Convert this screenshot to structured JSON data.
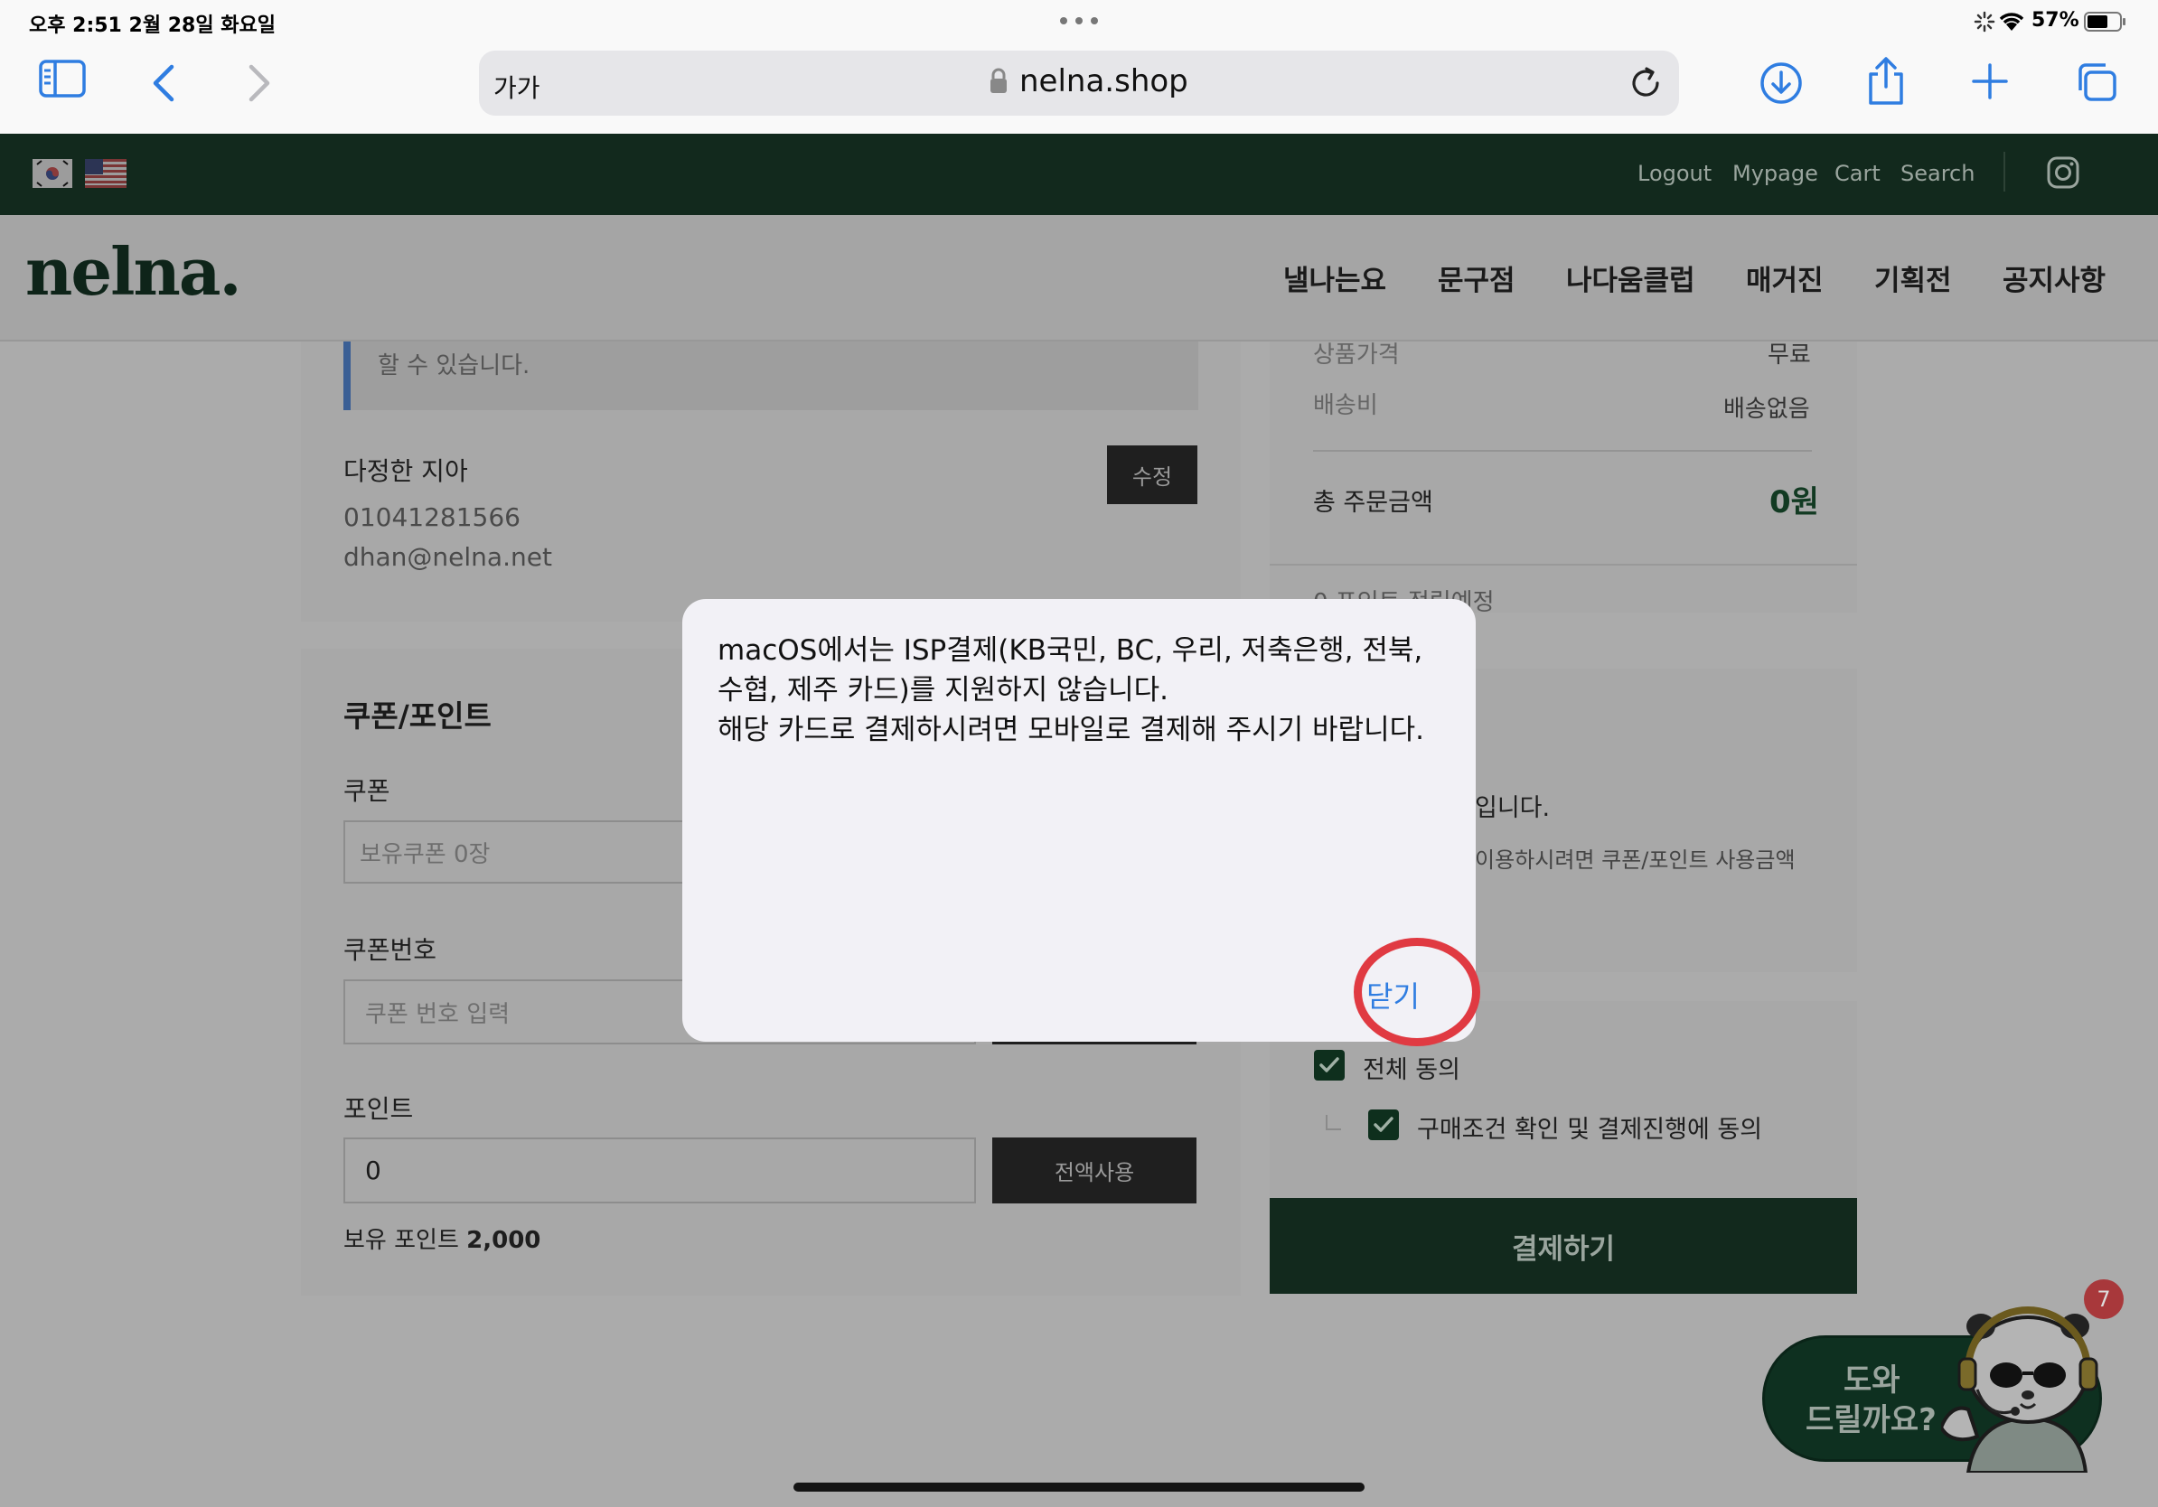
{
  "status_bar": {
    "time_date": "오후 2:51   2월 28일 화요일",
    "battery": "57%"
  },
  "safari": {
    "text_size_label": "가가",
    "url": "nelna.shop",
    "icons": [
      "sidebar-icon",
      "back-icon",
      "forward-icon",
      "lock-icon",
      "reload-icon",
      "download-icon",
      "share-icon",
      "new-tab-icon",
      "tabs-icon"
    ]
  },
  "site_top": {
    "links": [
      "Logout",
      "Mypage",
      "Cart",
      "Search"
    ],
    "flags": [
      "korea-flag-icon",
      "usa-flag-icon"
    ],
    "social": "instagram-icon"
  },
  "header": {
    "logo": "nelna.",
    "nav": [
      "낼나는요",
      "문구점",
      "나다움클럽",
      "매거진",
      "기획전",
      "공지사항"
    ]
  },
  "left": {
    "notice_tail": "할 수 있습니다.",
    "orderer_name": "다정한 지아",
    "phone": "01041281566",
    "email": "dhan@nelna.net",
    "edit_button": "수정",
    "coupon_section_title": "쿠폰/포인트",
    "coupon_label": "쿠폰",
    "coupon_placeholder": "보유쿠폰 0장",
    "coupon_code_label": "쿠폰번호",
    "coupon_code_placeholder": "쿠폰 번호 입력",
    "point_label": "포인트",
    "point_value": "0",
    "use_all_button": "전액사용",
    "owned_points_label": "보유 포인트",
    "owned_points_value": "2,000"
  },
  "right": {
    "product_price_label": "상품가격",
    "product_price_value": "무료",
    "shipping_label": "배송비",
    "shipping_value": "배송없음",
    "total_label": "총 주문금액",
    "total_value": "0원",
    "points_expected": "0 포인트 적립예정",
    "partial_text_1": "입니다.",
    "partial_text_2": "이용하시려면 쿠폰/포인트 사용금액",
    "agree_all": "전체 동의",
    "agree_terms": "구매조건 확인 및 결제진행에 동의",
    "pay_button": "결제하기"
  },
  "dialog": {
    "line1": "macOS에서는 ISP결제(KB국민, BC, 우리, 저축은행, 전북,",
    "line2": "수협, 제주 카드)를 지원하지 않습니다.",
    "line3": "해당 카드로 결제하시려면 모바일로 결제해 주시기 바랍니다.",
    "close_button": "닫기"
  },
  "chat_widget": {
    "line1": "도와",
    "line2": "드릴까요?",
    "badge_count": "7"
  }
}
